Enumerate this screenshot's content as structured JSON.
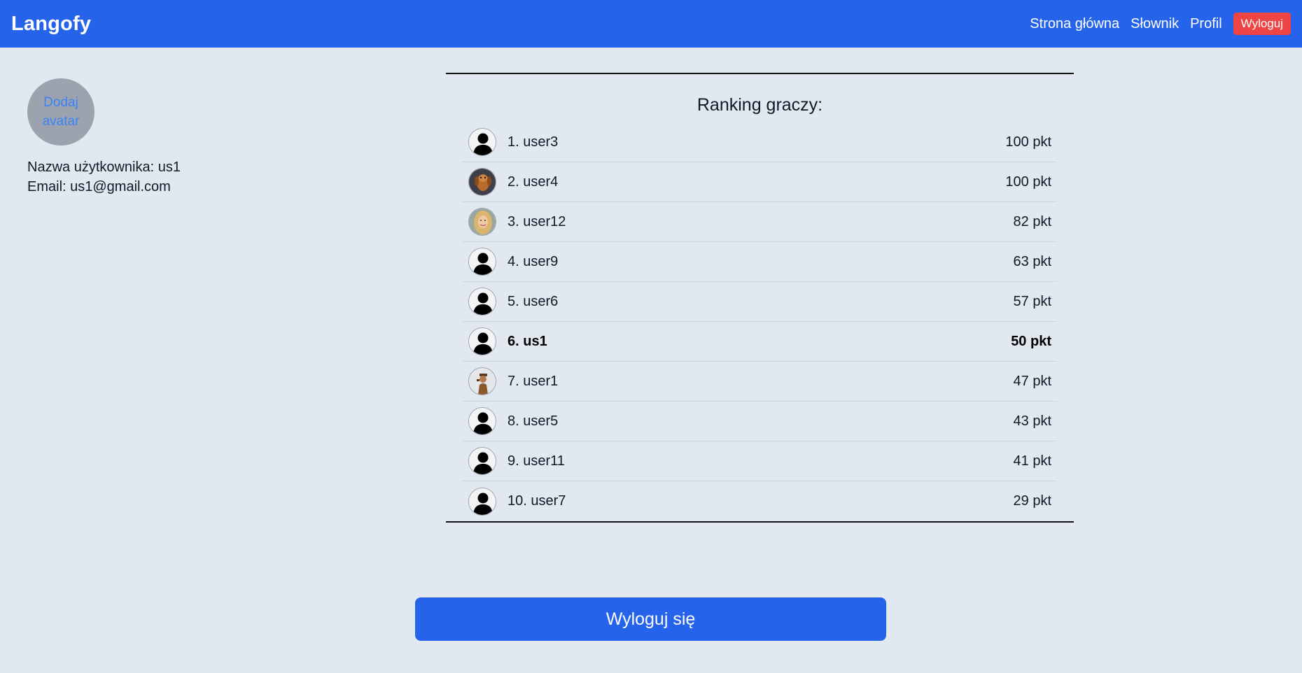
{
  "navbar": {
    "brand": "Langofy",
    "links": [
      "Strona główna",
      "Słownik",
      "Profil"
    ],
    "logout_label": "Wyloguj"
  },
  "profile": {
    "avatar_line1": "Dodaj",
    "avatar_line2": "avatar",
    "username_line": "Nazwa użytkownika: us1",
    "email_line": "Email: us1@gmail.com"
  },
  "ranking": {
    "title": "Ranking graczy:",
    "rows": [
      {
        "name": "1. user3",
        "points": "100 pkt",
        "avatar": "default-user-icon",
        "current": false
      },
      {
        "name": "2. user4",
        "points": "100 pkt",
        "avatar": "dog-photo",
        "current": false
      },
      {
        "name": "3. user12",
        "points": "82 pkt",
        "avatar": "woman-photo",
        "current": false
      },
      {
        "name": "4. user9",
        "points": "63 pkt",
        "avatar": "default-user-icon",
        "current": false
      },
      {
        "name": "5. user6",
        "points": "57 pkt",
        "avatar": "default-user-icon",
        "current": false
      },
      {
        "name": "6. us1",
        "points": "50 pkt",
        "avatar": "default-user-icon",
        "current": true
      },
      {
        "name": "7. user1",
        "points": "47 pkt",
        "avatar": "figure-photo",
        "current": false
      },
      {
        "name": "8. user5",
        "points": "43 pkt",
        "avatar": "default-user-icon",
        "current": false
      },
      {
        "name": "9. user11",
        "points": "41 pkt",
        "avatar": "default-user-icon",
        "current": false
      },
      {
        "name": "10. user7",
        "points": "29 pkt",
        "avatar": "default-user-icon",
        "current": false
      }
    ]
  },
  "logout_button_label": "Wyloguj się",
  "colors": {
    "primary": "#2563eb",
    "danger": "#ef4444",
    "background": "#e2e8f0",
    "avatar_placeholder": "#9ca3af"
  }
}
